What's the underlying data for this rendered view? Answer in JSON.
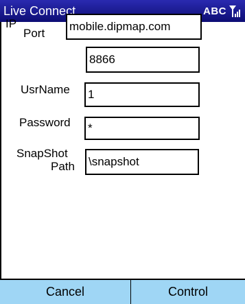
{
  "title_bar": {
    "title": "Live Connect",
    "ime_mode": "ABC",
    "signal_icon": "signal-strength-icon"
  },
  "form": {
    "ip": {
      "label": "IP",
      "value": "mobile.dipmap.com"
    },
    "port": {
      "label": "Port",
      "value": "8866"
    },
    "username": {
      "label": "UsrName",
      "value": "1"
    },
    "password": {
      "label": "Password",
      "value": "*"
    },
    "snapshot_path": {
      "label_line1": "SnapShot",
      "label_line2": "Path",
      "value": "\\snapshot"
    }
  },
  "softkeys": {
    "left": "Cancel",
    "right": "Control"
  },
  "colors": {
    "title_bar": "#1b1b8e",
    "softkey_bar": "#9fd6f5"
  }
}
